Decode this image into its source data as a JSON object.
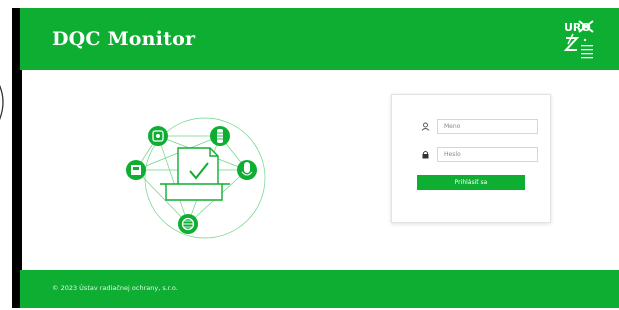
{
  "app": {
    "title": "DQC Monitor"
  },
  "login": {
    "username_placeholder": "Meno",
    "password_placeholder": "Heslo",
    "submit_label": "Prihlásiť sa"
  },
  "footer": {
    "copyright": "© 2023  Ústav radiačnej ochrany, s.r.o."
  },
  "icons": {
    "user": "user-icon",
    "lock": "lock-icon",
    "logo": "uro-logo"
  },
  "colors": {
    "brand_green": "#0dae32",
    "white": "#ffffff"
  }
}
